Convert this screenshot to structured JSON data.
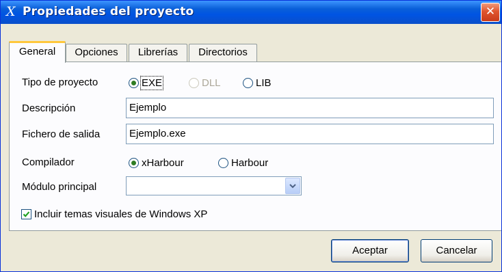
{
  "window": {
    "title": "Propiedades del proyecto",
    "app_icon_glyph": "X",
    "close_glyph": "✕"
  },
  "tabs": [
    {
      "label": "General",
      "active": true
    },
    {
      "label": "Opciones",
      "active": false
    },
    {
      "label": "Librerías",
      "active": false
    },
    {
      "label": "Directorios",
      "active": false
    }
  ],
  "general": {
    "tipo_label": "Tipo de proyecto",
    "tipo_options": [
      {
        "label": "EXE",
        "checked": true,
        "disabled": false
      },
      {
        "label": "DLL",
        "checked": false,
        "disabled": true
      },
      {
        "label": "LIB",
        "checked": false,
        "disabled": false
      }
    ],
    "descripcion_label": "Descripción",
    "descripcion_value": "Ejemplo",
    "salida_label": "Fichero de salida",
    "salida_value": "Ejemplo.exe",
    "compilador_label": "Compilador",
    "compilador_options": [
      {
        "label": "xHarbour",
        "checked": true
      },
      {
        "label": "Harbour",
        "checked": false
      }
    ],
    "modulo_label": "Módulo principal",
    "modulo_value": "",
    "xp_themes_label": "Incluir temas visuales de Windows XP",
    "xp_themes_checked": true
  },
  "buttons": {
    "accept": "Aceptar",
    "cancel": "Cancelar"
  },
  "colors": {
    "titlebar": "#0054e3",
    "dialog_bg": "#ece9d8",
    "close_button": "#e0552e",
    "tab_highlight": "#ffc83c",
    "radio_dot": "#2f7d23"
  },
  "icons": {
    "app": "app-x-icon",
    "close": "close-icon",
    "dropdown": "chevron-down-icon",
    "check": "checkmark-icon"
  }
}
